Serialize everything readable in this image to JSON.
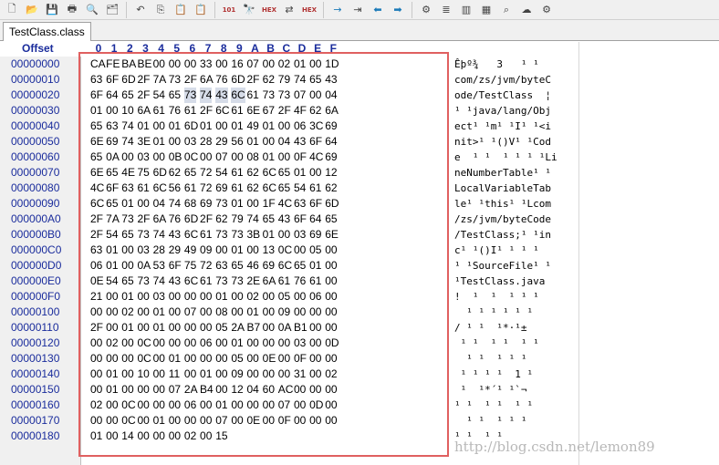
{
  "toolbar": {
    "icons": [
      "new-file",
      "open-file",
      "save",
      "print",
      "print-preview",
      "properties",
      "undo",
      "copy",
      "paste",
      "paste-special",
      "convert",
      "find",
      "find-hex",
      "replace",
      "replace-hex",
      "next",
      "previous",
      "back",
      "forward",
      "tools",
      "stack",
      "chip",
      "calculator",
      "search",
      "cloud",
      "gear"
    ],
    "find_hex_label": "HEX",
    "replace_hex_label": "HEX",
    "convert_label": "101"
  },
  "tab": {
    "title": "TestClass.class"
  },
  "header": {
    "offset_label": "Offset",
    "columns": [
      "0",
      "1",
      "2",
      "3",
      "4",
      "5",
      "6",
      "7",
      "8",
      "9",
      "A",
      "B",
      "C",
      "D",
      "E",
      "F"
    ]
  },
  "rows": [
    {
      "offset": "00000000",
      "hex": [
        "CA",
        "FE",
        "BA",
        "BE",
        "00",
        "00",
        "00",
        "33",
        "00",
        "16",
        "07",
        "00",
        "02",
        "01",
        "00",
        "1D"
      ],
      "ascii": "Êþº¾   3   ¹ ¹"
    },
    {
      "offset": "00000010",
      "hex": [
        "63",
        "6F",
        "6D",
        "2F",
        "7A",
        "73",
        "2F",
        "6A",
        "76",
        "6D",
        "2F",
        "62",
        "79",
        "74",
        "65",
        "43"
      ],
      "ascii": "com/zs/jvm/byteC"
    },
    {
      "offset": "00000020",
      "hex": [
        "6F",
        "64",
        "65",
        "2F",
        "54",
        "65",
        "73",
        "74",
        "43",
        "6C",
        "61",
        "73",
        "73",
        "07",
        "00",
        "04"
      ],
      "ascii": "ode/TestClass  ¦"
    },
    {
      "offset": "00000030",
      "hex": [
        "01",
        "00",
        "10",
        "6A",
        "61",
        "76",
        "61",
        "2F",
        "6C",
        "61",
        "6E",
        "67",
        "2F",
        "4F",
        "62",
        "6A"
      ],
      "ascii": "¹ ¹java/lang/Obj"
    },
    {
      "offset": "00000040",
      "hex": [
        "65",
        "63",
        "74",
        "01",
        "00",
        "01",
        "6D",
        "01",
        "00",
        "01",
        "49",
        "01",
        "00",
        "06",
        "3C",
        "69"
      ],
      "ascii": "ect¹ ¹m¹ ¹I¹ ¹<i"
    },
    {
      "offset": "00000050",
      "hex": [
        "6E",
        "69",
        "74",
        "3E",
        "01",
        "00",
        "03",
        "28",
        "29",
        "56",
        "01",
        "00",
        "04",
        "43",
        "6F",
        "64"
      ],
      "ascii": "nit>¹ ¹()V¹ ¹Cod"
    },
    {
      "offset": "00000060",
      "hex": [
        "65",
        "0A",
        "00",
        "03",
        "00",
        "0B",
        "0C",
        "00",
        "07",
        "00",
        "08",
        "01",
        "00",
        "0F",
        "4C",
        "69"
      ],
      "ascii": "e  ¹ ¹  ¹ ¹ ¹ ¹Li"
    },
    {
      "offset": "00000070",
      "hex": [
        "6E",
        "65",
        "4E",
        "75",
        "6D",
        "62",
        "65",
        "72",
        "54",
        "61",
        "62",
        "6C",
        "65",
        "01",
        "00",
        "12"
      ],
      "ascii": "neNumberTable¹ ¹"
    },
    {
      "offset": "00000080",
      "hex": [
        "4C",
        "6F",
        "63",
        "61",
        "6C",
        "56",
        "61",
        "72",
        "69",
        "61",
        "62",
        "6C",
        "65",
        "54",
        "61",
        "62"
      ],
      "ascii": "LocalVariableTab"
    },
    {
      "offset": "00000090",
      "hex": [
        "6C",
        "65",
        "01",
        "00",
        "04",
        "74",
        "68",
        "69",
        "73",
        "01",
        "00",
        "1F",
        "4C",
        "63",
        "6F",
        "6D"
      ],
      "ascii": "le¹ ¹this¹ ¹Lcom"
    },
    {
      "offset": "000000A0",
      "hex": [
        "2F",
        "7A",
        "73",
        "2F",
        "6A",
        "76",
        "6D",
        "2F",
        "62",
        "79",
        "74",
        "65",
        "43",
        "6F",
        "64",
        "65"
      ],
      "ascii": "/zs/jvm/byteCode"
    },
    {
      "offset": "000000B0",
      "hex": [
        "2F",
        "54",
        "65",
        "73",
        "74",
        "43",
        "6C",
        "61",
        "73",
        "73",
        "3B",
        "01",
        "00",
        "03",
        "69",
        "6E"
      ],
      "ascii": "/TestClass;¹ ¹in"
    },
    {
      "offset": "000000C0",
      "hex": [
        "63",
        "01",
        "00",
        "03",
        "28",
        "29",
        "49",
        "09",
        "00",
        "01",
        "00",
        "13",
        "0C",
        "00",
        "05",
        "00"
      ],
      "ascii": "c¹ ¹()I¹ ¹ ¹ ¹"
    },
    {
      "offset": "000000D0",
      "hex": [
        "06",
        "01",
        "00",
        "0A",
        "53",
        "6F",
        "75",
        "72",
        "63",
        "65",
        "46",
        "69",
        "6C",
        "65",
        "01",
        "00"
      ],
      "ascii": "¹ ¹SourceFile¹ ¹"
    },
    {
      "offset": "000000E0",
      "hex": [
        "0E",
        "54",
        "65",
        "73",
        "74",
        "43",
        "6C",
        "61",
        "73",
        "73",
        "2E",
        "6A",
        "61",
        "76",
        "61",
        "00"
      ],
      "ascii": "¹TestClass.java"
    },
    {
      "offset": "000000F0",
      "hex": [
        "21",
        "00",
        "01",
        "00",
        "03",
        "00",
        "00",
        "00",
        "01",
        "00",
        "02",
        "00",
        "05",
        "00",
        "06",
        "00"
      ],
      "ascii": "!  ¹  ¹  ¹ ¹ ¹"
    },
    {
      "offset": "00000100",
      "hex": [
        "00",
        "00",
        "02",
        "00",
        "01",
        "00",
        "07",
        "00",
        "08",
        "00",
        "01",
        "00",
        "09",
        "00",
        "00",
        "00"
      ],
      "ascii": "  ¹ ¹ ¹ ¹ ¹ ¹"
    },
    {
      "offset": "00000110",
      "hex": [
        "2F",
        "00",
        "01",
        "00",
        "01",
        "00",
        "00",
        "00",
        "05",
        "2A",
        "B7",
        "00",
        "0A",
        "B1",
        "00",
        "00"
      ],
      "ascii": "/ ¹ ¹  ¹*·¹±"
    },
    {
      "offset": "00000120",
      "hex": [
        "00",
        "02",
        "00",
        "0C",
        "00",
        "00",
        "00",
        "06",
        "00",
        "01",
        "00",
        "00",
        "00",
        "03",
        "00",
        "0D"
      ],
      "ascii": " ¹ ¹  ¹ ¹  ¹ ¹"
    },
    {
      "offset": "00000130",
      "hex": [
        "00",
        "00",
        "00",
        "0C",
        "00",
        "01",
        "00",
        "00",
        "00",
        "05",
        "00",
        "0E",
        "00",
        "0F",
        "00",
        "00"
      ],
      "ascii": "  ¹ ¹  ¹ ¹ ¹"
    },
    {
      "offset": "00000140",
      "hex": [
        "00",
        "01",
        "00",
        "10",
        "00",
        "11",
        "00",
        "01",
        "00",
        "09",
        "00",
        "00",
        "00",
        "31",
        "00",
        "02"
      ],
      "ascii": " ¹ ¹ ¹ ¹  1 ¹"
    },
    {
      "offset": "00000150",
      "hex": [
        "00",
        "01",
        "00",
        "00",
        "00",
        "07",
        "2A",
        "B4",
        "00",
        "12",
        "04",
        "60",
        "AC",
        "00",
        "00",
        "00"
      ],
      "ascii": " ¹  ¹*´¹ ¹`¬"
    },
    {
      "offset": "00000160",
      "hex": [
        "02",
        "00",
        "0C",
        "00",
        "00",
        "00",
        "06",
        "00",
        "01",
        "00",
        "00",
        "00",
        "07",
        "00",
        "0D",
        "00"
      ],
      "ascii": "¹ ¹  ¹ ¹  ¹ ¹"
    },
    {
      "offset": "00000170",
      "hex": [
        "00",
        "00",
        "0C",
        "00",
        "01",
        "00",
        "00",
        "00",
        "07",
        "00",
        "0E",
        "00",
        "0F",
        "00",
        "00",
        "00"
      ],
      "ascii": "  ¹ ¹  ¹ ¹ ¹"
    },
    {
      "offset": "00000180",
      "hex": [
        "01",
        "00",
        "14",
        "00",
        "00",
        "00",
        "02",
        "00",
        "15"
      ],
      "ascii": "¹ ¹  ¹ ¹"
    }
  ],
  "highlight": {
    "row": 2,
    "start": 6,
    "end": 9,
    "color": "#d6dce8"
  },
  "selection_color": "#e06060",
  "watermark": "http://blog.csdn.net/lemon89"
}
